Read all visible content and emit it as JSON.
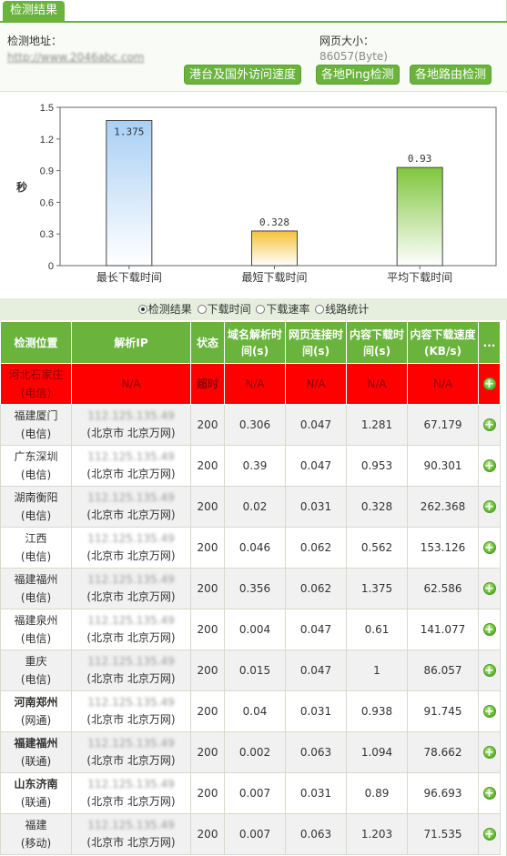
{
  "title": "检测结果",
  "info": {
    "address_label": "检测地址：",
    "address_value": "http://www.2046abc.com",
    "size_label": "网页大小：",
    "size_value": "86057(Byte)"
  },
  "buttons": {
    "intl": "港台及国外访问速度",
    "ping": "各地Ping检测",
    "route": "各地路由检测"
  },
  "chart_data": {
    "type": "bar",
    "categories": [
      "最长下载时间",
      "最短下载时间",
      "平均下载时间"
    ],
    "values": [
      1.375,
      0.328,
      0.93
    ],
    "ylabel": "秒",
    "ylim": [
      0,
      1.5
    ],
    "yticks": [
      "0",
      "0.3",
      "0.6",
      "0.9",
      "1.2",
      "1.5"
    ],
    "value_labels": [
      "1.375",
      "0.328",
      "0.93"
    ],
    "grid": false,
    "colors": [
      "#a9d0f5",
      "#f5c236",
      "#7fc63c"
    ]
  },
  "radios": [
    {
      "label": "检测结果",
      "selected": true
    },
    {
      "label": "下载时间",
      "selected": false
    },
    {
      "label": "下载速率",
      "selected": false
    },
    {
      "label": "线路统计",
      "selected": false
    }
  ],
  "table": {
    "headers": [
      "检测位置",
      "解析IP",
      "状态",
      "域名解析时间(s)",
      "网页连接时间(s)",
      "内容下载时间(s)",
      "内容下载速度(KB/s)",
      "..."
    ],
    "rows": [
      {
        "loc1": "河北石家庄",
        "loc2": "(电信)",
        "ip": "",
        "ipnet": "N/A",
        "status": "超时",
        "dns": "N/A",
        "conn": "N/A",
        "dl": "N/A",
        "speed": "N/A"
      },
      {
        "loc1": "福建厦门",
        "loc2": "(电信)",
        "ip": "112.125.135.49",
        "ipnet": "(北京市 北京万网)",
        "status": "200",
        "dns": "0.306",
        "conn": "0.047",
        "dl": "1.281",
        "speed": "67.179"
      },
      {
        "loc1": "广东深圳",
        "loc2": "(电信)",
        "ip": "112.125.135.49",
        "ipnet": "(北京市 北京万网)",
        "status": "200",
        "dns": "0.39",
        "conn": "0.047",
        "dl": "0.953",
        "speed": "90.301"
      },
      {
        "loc1": "湖南衡阳",
        "loc2": "(电信)",
        "ip": "112.125.135.49",
        "ipnet": "(北京市 北京万网)",
        "status": "200",
        "dns": "0.02",
        "conn": "0.031",
        "dl": "0.328",
        "speed": "262.368"
      },
      {
        "loc1": "江西",
        "loc2": "(电信)",
        "ip": "112.125.135.49",
        "ipnet": "(北京市 北京万网)",
        "status": "200",
        "dns": "0.046",
        "conn": "0.062",
        "dl": "0.562",
        "speed": "153.126"
      },
      {
        "loc1": "福建福州",
        "loc2": "(电信)",
        "ip": "112.125.135.49",
        "ipnet": "(北京市 北京万网)",
        "status": "200",
        "dns": "0.356",
        "conn": "0.062",
        "dl": "1.375",
        "speed": "62.586"
      },
      {
        "loc1": "福建泉州",
        "loc2": "(电信)",
        "ip": "112.125.135.49",
        "ipnet": "(北京市 北京万网)",
        "status": "200",
        "dns": "0.004",
        "conn": "0.047",
        "dl": "0.61",
        "speed": "141.077"
      },
      {
        "loc1": "重庆",
        "loc2": "(电信)",
        "ip": "112.125.135.49",
        "ipnet": "(北京市 北京万网)",
        "status": "200",
        "dns": "0.015",
        "conn": "0.047",
        "dl": "1",
        "speed": "86.057"
      },
      {
        "loc1": "河南郑州",
        "loc2": "(网通)",
        "ip": "112.125.135.49",
        "ipnet": "(北京市 北京万网)",
        "status": "200",
        "dns": "0.04",
        "conn": "0.031",
        "dl": "0.938",
        "speed": "91.745"
      },
      {
        "loc1": "福建福州",
        "loc2": "(联通)",
        "ip": "112.125.135.49",
        "ipnet": "(北京市 北京万网)",
        "status": "200",
        "dns": "0.002",
        "conn": "0.063",
        "dl": "1.094",
        "speed": "78.662"
      },
      {
        "loc1": "山东济南",
        "loc2": "(联通)",
        "ip": "112.125.135.49",
        "ipnet": "(北京市 北京万网)",
        "status": "200",
        "dns": "0.007",
        "conn": "0.031",
        "dl": "0.89",
        "speed": "96.693"
      },
      {
        "loc1": "福建",
        "loc2": "(移动)",
        "ip": "112.125.135.49",
        "ipnet": "(北京市 北京万网)",
        "status": "200",
        "dns": "0.007",
        "conn": "0.063",
        "dl": "1.203",
        "speed": "71.535"
      }
    ]
  }
}
